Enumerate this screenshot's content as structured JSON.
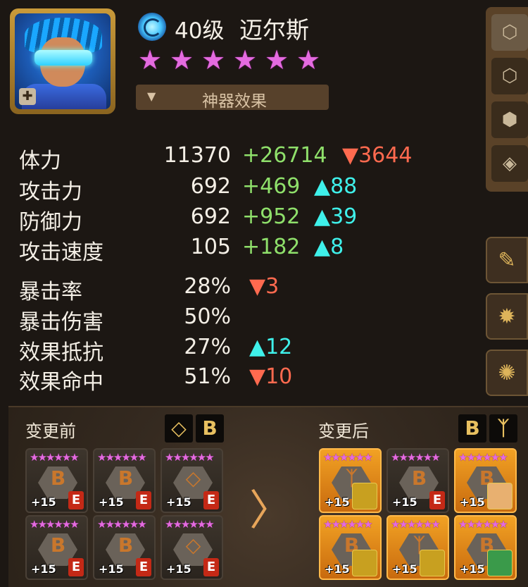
{
  "hero": {
    "level": "40级",
    "name": "迈尔斯",
    "stars": 6,
    "element_icon": "wind-element-icon",
    "class_icon": "cross-class-icon"
  },
  "artifact": {
    "label": "神器效果",
    "arrow": "▼"
  },
  "stats": [
    {
      "label": "体力",
      "base": "11370",
      "bonus": "+26714",
      "diff": "3644",
      "dir": "down"
    },
    {
      "label": "攻击力",
      "base": "692",
      "bonus": "+469",
      "diff": "88",
      "dir": "up"
    },
    {
      "label": "防御力",
      "base": "692",
      "bonus": "+952",
      "diff": "39",
      "dir": "up"
    },
    {
      "label": "攻击速度",
      "base": "105",
      "bonus": "+182",
      "diff": "8",
      "dir": "up"
    },
    {
      "label": "暴击率",
      "base": "28%",
      "bonus": "",
      "diff": "3",
      "dir": "down"
    },
    {
      "label": "暴击伤害",
      "base": "50%",
      "bonus": "",
      "diff": "",
      "dir": ""
    },
    {
      "label": "效果抵抗",
      "base": "27%",
      "bonus": "",
      "diff": "12",
      "dir": "up"
    },
    {
      "label": "效果命中",
      "base": "51%",
      "bonus": "",
      "diff": "10",
      "dir": "down"
    }
  ],
  "compare": {
    "before_title": "变更前",
    "after_title": "变更后",
    "before_sets": [
      "◇",
      "B"
    ],
    "after_sets": [
      "B",
      "ᛉ"
    ],
    "before_runes": [
      {
        "glyph": "B",
        "level": "+15",
        "badge": "E",
        "style": "grey"
      },
      {
        "glyph": "B",
        "level": "+15",
        "badge": "E",
        "style": "grey"
      },
      {
        "glyph": "◇",
        "level": "+15",
        "badge": "E",
        "style": "grey"
      },
      {
        "glyph": "B",
        "level": "+15",
        "badge": "E",
        "style": "grey"
      },
      {
        "glyph": "B",
        "level": "+15",
        "badge": "E",
        "style": "grey"
      },
      {
        "glyph": "◇",
        "level": "+15",
        "badge": "E",
        "style": "grey"
      }
    ],
    "after_runes": [
      {
        "glyph": "ᛉ",
        "level": "+15",
        "badge": "",
        "style": "gold",
        "monster": "#c8a020"
      },
      {
        "glyph": "B",
        "level": "+15",
        "badge": "E",
        "style": "grey"
      },
      {
        "glyph": "B",
        "level": "+15",
        "badge": "",
        "style": "gold",
        "monster": "#e8b070"
      },
      {
        "glyph": "B",
        "level": "+15",
        "badge": "",
        "style": "gold",
        "monster": "#c8a020"
      },
      {
        "glyph": "ᛉ",
        "level": "+15",
        "badge": "",
        "style": "gold",
        "monster": "#c8a020"
      },
      {
        "glyph": "B",
        "level": "+15",
        "badge": "",
        "style": "gold",
        "monster": "#3a9a4a"
      }
    ],
    "stars_text": "★★★★★★",
    "next_arrow": "〉"
  },
  "side_tabs": [
    "hexagon-rune-icon",
    "rune-slot-icon",
    "cube-icon",
    "tag-icon"
  ],
  "side_buttons": [
    "edit-settings-icon",
    "rune-set-icon",
    "rune-remove-icon"
  ],
  "colors": {
    "up": "#3ff0ea",
    "down": "#ff6a4f",
    "bonus": "#8fe06b",
    "star": "#e46be0"
  }
}
